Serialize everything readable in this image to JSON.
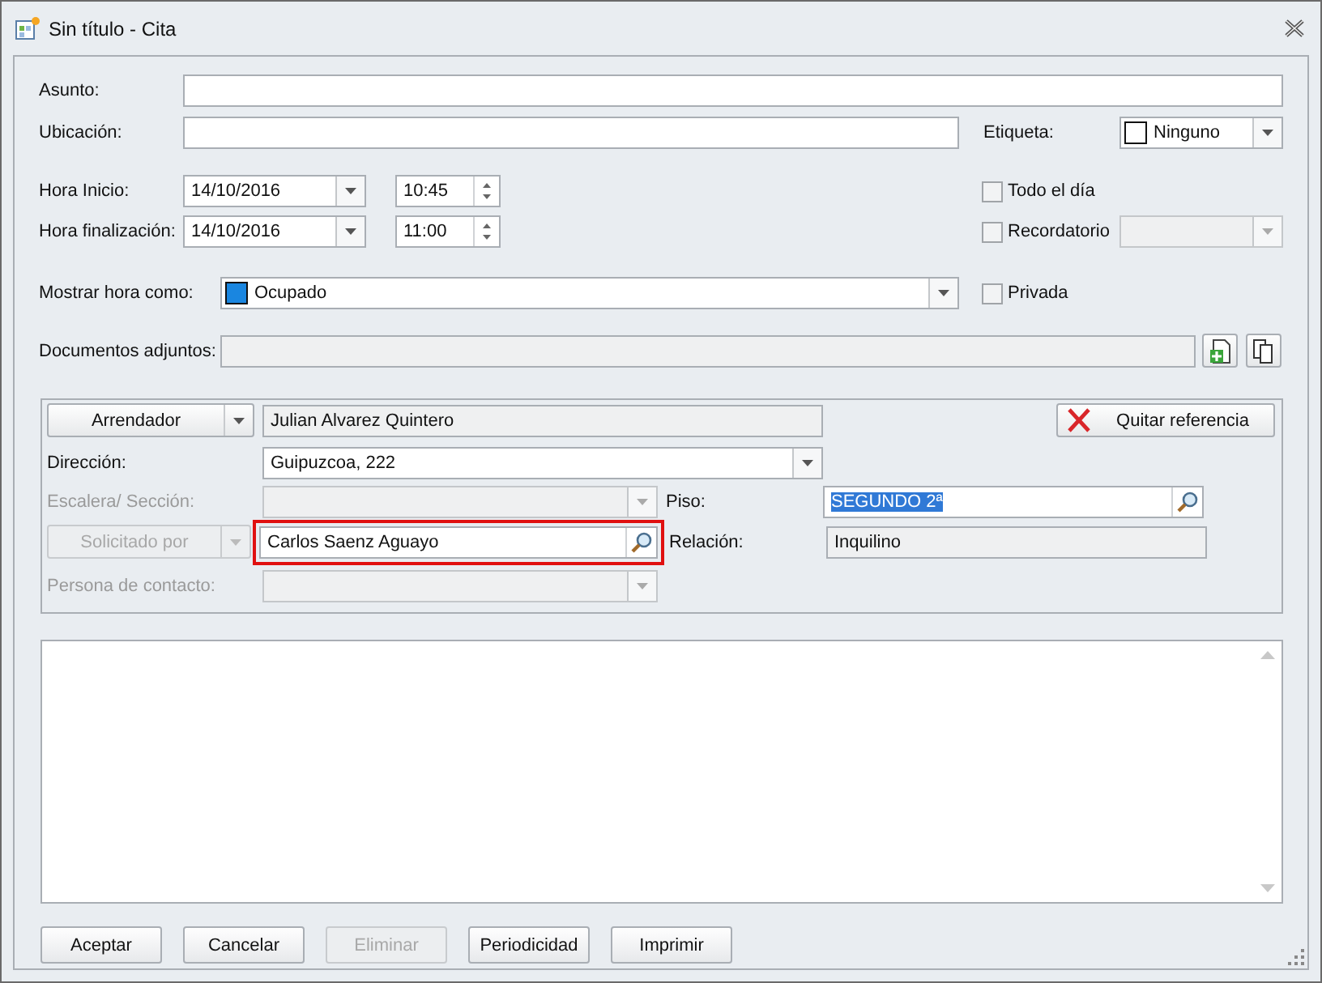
{
  "window": {
    "title": "Sin título - Cita"
  },
  "subject": {
    "label": "Asunto:"
  },
  "location": {
    "label": "Ubicación:"
  },
  "tag": {
    "label": "Etiqueta:",
    "value": "Ninguno",
    "color": "#ffffff"
  },
  "times": [
    {
      "label": "Hora Inicio:",
      "date": "14/10/2016",
      "time": "10:45"
    },
    {
      "label": "Hora finalización:",
      "date": "14/10/2016",
      "time": "11:00"
    }
  ],
  "all_day": {
    "label": "Todo el día",
    "checked": false
  },
  "reminder": {
    "label": "Recordatorio",
    "checked": false
  },
  "show_as": {
    "label": "Mostrar hora como:",
    "value": "Ocupado",
    "color": "#1a86e0"
  },
  "private": {
    "label": "Privada",
    "checked": false
  },
  "attachments": {
    "label": "Documentos adjuntos:"
  },
  "reference": {
    "role_button": "Arrendador",
    "name": "Julian Alvarez Quintero",
    "remove_button": "Quitar referencia",
    "address": {
      "label": "Dirección:",
      "value": "Guipuzcoa, 222"
    },
    "stair": {
      "label": "Escalera/ Sección:",
      "disabled": true
    },
    "floor": {
      "label": "Piso:",
      "value": "SEGUNDO 2ª",
      "selected": true
    },
    "requested_by": {
      "button": "Solicitado por",
      "value": "Carlos Saenz Aguayo",
      "disabled": true,
      "highlighted": true
    },
    "relation": {
      "label": "Relación:",
      "value": "Inquilino"
    },
    "contact": {
      "label": "Persona de contacto:",
      "disabled": true
    }
  },
  "buttons": [
    {
      "label": "Aceptar",
      "disabled": false
    },
    {
      "label": "Cancelar",
      "disabled": false
    },
    {
      "label": "Eliminar",
      "disabled": true
    },
    {
      "label": "Periodicidad",
      "disabled": false
    },
    {
      "label": "Imprimir",
      "disabled": false
    }
  ]
}
